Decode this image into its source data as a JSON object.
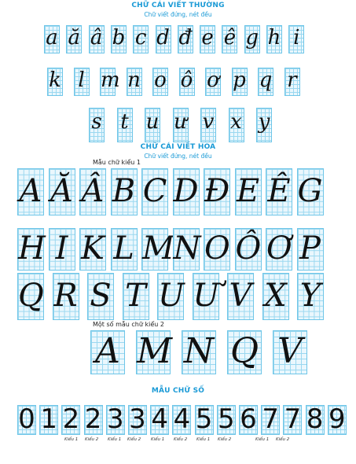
{
  "title_lower": "CHỮ CÁI VIẾT THƯỜNG",
  "subtitle_lower": "Chữ viết đứng, nét đều",
  "lower_row1": [
    "a",
    "ă",
    "â",
    "b",
    "c",
    "d",
    "đ",
    "e",
    "ê",
    "g",
    "h",
    "i"
  ],
  "lower_row2": [
    "k",
    "l",
    "m",
    "n",
    "o",
    "ô",
    "ơ",
    "p",
    "q",
    "r"
  ],
  "lower_row3": [
    "s",
    "t",
    "u",
    "ư",
    "v",
    "x",
    "y"
  ],
  "title_upper": "CHỮ CÁI VIẾT HOA",
  "subtitle_upper": "Chữ viết đứng, nét đều",
  "label_style1": "Mẫu chữ kiểu 1",
  "upper_row1": [
    "A",
    "Ă",
    "Â",
    "B",
    "C",
    "D",
    "Đ",
    "E",
    "Ê",
    "G"
  ],
  "upper_row2": [
    "H",
    "I",
    "K",
    "L",
    "M",
    "N",
    "O",
    "Ô",
    "Ơ",
    "P"
  ],
  "upper_row3": [
    "Q",
    "R",
    "S",
    "T",
    "U",
    "Ư",
    "V",
    "X",
    "Y"
  ],
  "label_style2": "Một số mẫu chữ kiểu 2",
  "upper_style2": [
    "A",
    "M",
    "N",
    "Q",
    "V"
  ],
  "title_digits": "MẪU CHỮ SỐ",
  "digits": [
    "0",
    "1",
    "2",
    "2",
    "3",
    "3",
    "4",
    "4",
    "5",
    "5",
    "6",
    "7",
    "7",
    "8",
    "9"
  ],
  "digit_styles": [
    "Kiểu 1",
    "Kiểu 2",
    "Kiểu 1",
    "Kiểu 2",
    "Kiểu 1",
    "Kiểu 2",
    "Kiểu 1",
    "Kiểu 2",
    "Kiểu 1",
    "Kiểu 2"
  ],
  "colors": {
    "heading": "#1a9ad6",
    "grid": "#9ad8f0",
    "grid_bg": "#eaf7fd",
    "ink": "#111111"
  }
}
